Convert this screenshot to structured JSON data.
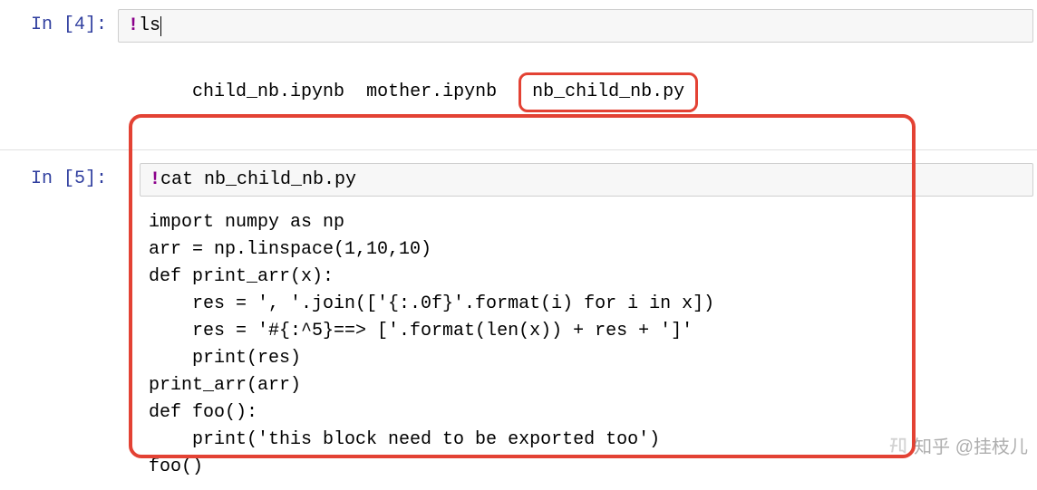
{
  "cell1": {
    "prompt": "In [4]:",
    "bang": "!",
    "cmd": "ls",
    "output": {
      "file1": "child_nb.ipynb",
      "file2": "mother.ipynb",
      "file3": "nb_child_nb.py"
    }
  },
  "cell2": {
    "prompt": "In [5]:",
    "bang": "!",
    "cmd": "cat nb_child_nb.py",
    "output": "import numpy as np\narr = np.linspace(1,10,10)\ndef print_arr(x):\n    res = ', '.join(['{:.0f}'.format(i) for i in x])\n    res = '#{:^5}==> ['.format(len(x)) + res + ']'\n    print(res)\nprint_arr(arr)\ndef foo():\n    print('this block need to be exported too')\nfoo()"
  },
  "watermark": "知乎 @挂枝儿",
  "colors": {
    "annotation": "#e34234",
    "prompt": "#303F9F",
    "bang": "#8B008B",
    "input_bg": "#f7f7f7",
    "input_border": "#cfcfcf"
  }
}
